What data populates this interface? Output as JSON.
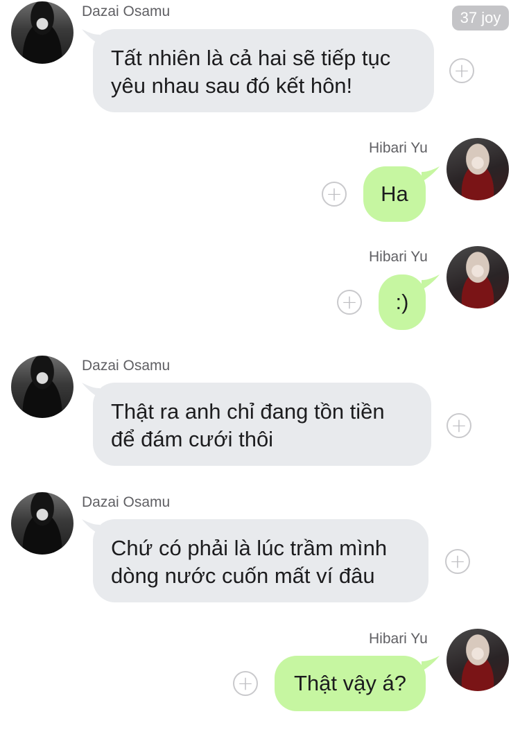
{
  "header": {
    "badge": "37 joy"
  },
  "messages": [
    {
      "sender": "Dazai Osamu",
      "side": "left",
      "lines": [
        "Tất nhiên là cả hai sẽ tiếp tục",
        "yêu nhau sau đó kết hôn!"
      ]
    },
    {
      "sender": "Hibari Yu",
      "side": "right",
      "lines": [
        "Ha"
      ]
    },
    {
      "sender": "Hibari Yu",
      "side": "right",
      "lines": [
        ":)"
      ]
    },
    {
      "sender": "Dazai Osamu",
      "side": "left",
      "lines": [
        "Thật ra anh chỉ đang tồn tiền",
        "để đám cưới thôi"
      ]
    },
    {
      "sender": "Dazai Osamu",
      "side": "left",
      "lines": [
        "Chứ có phải là lúc trầm mình",
        "dòng nước cuốn mất ví đâu"
      ]
    },
    {
      "sender": "Hibari Yu",
      "side": "right",
      "lines": [
        "Thật vậy á?"
      ]
    }
  ],
  "icons": {
    "add": "plus-circle-icon",
    "avatar_left": "avatar-dazai",
    "avatar_right": "avatar-hibari"
  },
  "colors": {
    "left_bubble": "#e8eaed",
    "right_bubble": "#c6f6a1",
    "name": "#5f5f63",
    "badge": "#c4c4c7"
  },
  "plus_glyph": "+"
}
